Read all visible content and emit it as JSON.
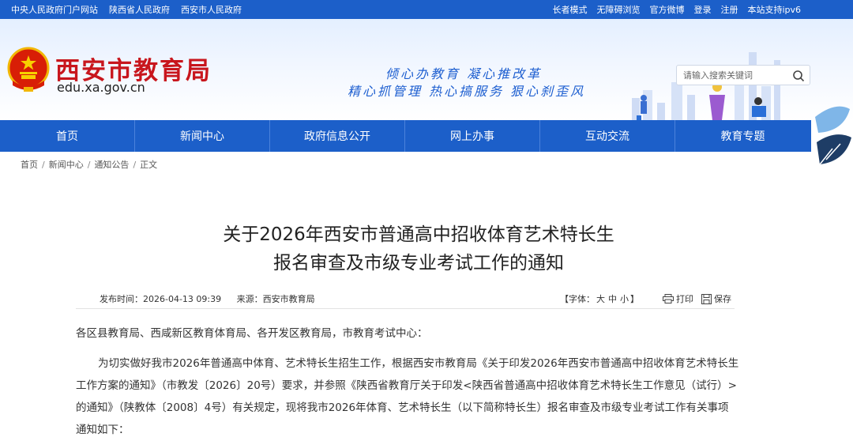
{
  "topbar": {
    "left_links": [
      "中央人民政府门户网站",
      "陕西省人民政府",
      "西安市人民政府"
    ],
    "right_links": [
      "长者模式",
      "无障碍浏览",
      "官方微博",
      "登录",
      "注册",
      "本站支持ipv6"
    ]
  },
  "header": {
    "site_title": "西安市教育局",
    "domain": "edu.xa.gov.cn",
    "slogan_line1": "倾心办教育  凝心推改革",
    "slogan_line2": "精心抓管理  热心搞服务  狠心刹歪风",
    "search_placeholder": "请输入搜索关键词",
    "icons": {
      "emblem": "national-emblem",
      "search": "search-icon"
    },
    "colors": {
      "brand_red": "#c8161d",
      "brand_blue": "#1c5fc9"
    }
  },
  "nav": {
    "items": [
      "首页",
      "新闻中心",
      "政府信息公开",
      "网上办事",
      "互动交流",
      "教育专题"
    ]
  },
  "breadcrumb": {
    "items": [
      "首页",
      "新闻中心",
      "通知公告",
      "正文"
    ],
    "separator": "/"
  },
  "article": {
    "title_line1": "关于2026年西安市普通高中招收体育艺术特长生",
    "title_line2": "报名审查及市级专业考试工作的通知",
    "publish_time": "发布时间：2026-04-13 09:39",
    "source": "来源：西安市教育局",
    "font_size_label": "【字体：",
    "font_size_options": [
      "大",
      "中",
      "小"
    ],
    "font_size_close": "】",
    "print_label": "打印",
    "save_label": "保存",
    "salutation": "各区县教育局、西咸新区教育体育局、各开发区教育局，市教育考试中心：",
    "paragraph1": "为切实做好我市2026年普通高中体育、艺术特长生招生工作，根据西安市教育局《关于印发2026年西安市普通高中招收体育艺术特长生工作方案的通知》（市教发〔2026〕20号）要求，并参照《陕西省教育厅关于印发<陕西省普通高中招收体育艺术特长生工作意见（试行）>的通知》（陕教体〔2008〕4号）有关规定，现将我市2026年体育、艺术特长生（以下简称特长生）报名审查及市级专业考试工作有关事项通知如下："
  }
}
